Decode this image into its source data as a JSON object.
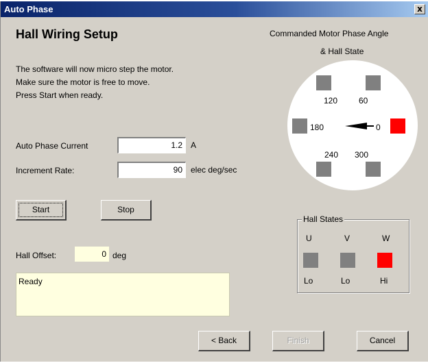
{
  "window": {
    "title": "Auto Phase",
    "close_glyph": "x"
  },
  "page": {
    "heading": "Hall Wiring Setup",
    "instructions": [
      "The software will now micro step the motor.",
      "Make sure the motor is free to move.",
      "Press Start when ready."
    ]
  },
  "fields": {
    "auto_phase_current": {
      "label": "Auto Phase Current",
      "value": "1.2",
      "unit": "A"
    },
    "increment_rate": {
      "label": "Increment Rate:",
      "value": "90",
      "unit": "elec deg/sec"
    },
    "hall_offset": {
      "label": "Hall Offset:",
      "value": "0",
      "unit": "deg"
    }
  },
  "buttons": {
    "start": "Start",
    "stop": "Stop",
    "back": "< Back",
    "finish": "Finish",
    "cancel": "Cancel"
  },
  "status": {
    "text": "Ready"
  },
  "phase_diagram": {
    "title_line1": "Commanded Motor Phase Angle",
    "title_line2": "& Hall State",
    "angle_labels": {
      "a120": "120",
      "a60": "60",
      "a180": "180",
      "a0": "0",
      "a240": "240",
      "a300": "300"
    },
    "commanded_angle_deg": 0,
    "active_position": "0"
  },
  "hall_states": {
    "group_label": "Hall States",
    "phases": [
      {
        "name": "U",
        "state": "Lo"
      },
      {
        "name": "V",
        "state": "Lo"
      },
      {
        "name": "W",
        "state": "Hi"
      }
    ]
  },
  "colors": {
    "active": "#ff0000",
    "inactive": "#808080",
    "status_bg": "#ffffe0"
  }
}
